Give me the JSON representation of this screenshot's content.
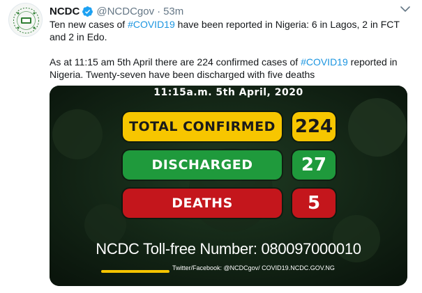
{
  "tweet": {
    "display_name": "NCDC",
    "handle": "@NCDCgov",
    "separator": "·",
    "time": "53m",
    "avatar_icon": "ncdc-logo-icon",
    "verified_icon": "verified-badge-icon",
    "menu_icon": "chevron-down-icon",
    "hashtag_color": "#1b95e0",
    "paragraph1": {
      "line1_a": "Ten new cases of ",
      "line1_hashtag": "#COVID19",
      "line1_b": " have been reported in Nigeria: 6 in Lagos, 2 in FCT",
      "line2": "and 2 in Edo."
    },
    "paragraph2": {
      "line1_a": "As at 11:15 am 5th April there are 224 confirmed cases of ",
      "line1_hashtag": "#COVID19",
      "line1_b": " reported in",
      "line2": "Nigeria. Twenty-seven have been discharged with five deaths"
    }
  },
  "infographic": {
    "date": "11:15a.m. 5th April, 2020",
    "stats": [
      {
        "label": "TOTAL CONFIRMED",
        "value": "224",
        "bg": "#f7c600",
        "fg": "#1a1a1a"
      },
      {
        "label": "DISCHARGED",
        "value": "27",
        "bg": "#1f9a3c",
        "fg": "#ffffff"
      },
      {
        "label": "DEATHS",
        "value": "5",
        "bg": "#c4161c",
        "fg": "#ffffff"
      }
    ],
    "tollfree": "NCDC Toll-free Number: 080097000010",
    "social": "Twitter/Facebook: @NCDCgov/ COVID19.NCDC.GOV.NG",
    "accent": "#f5c400"
  }
}
